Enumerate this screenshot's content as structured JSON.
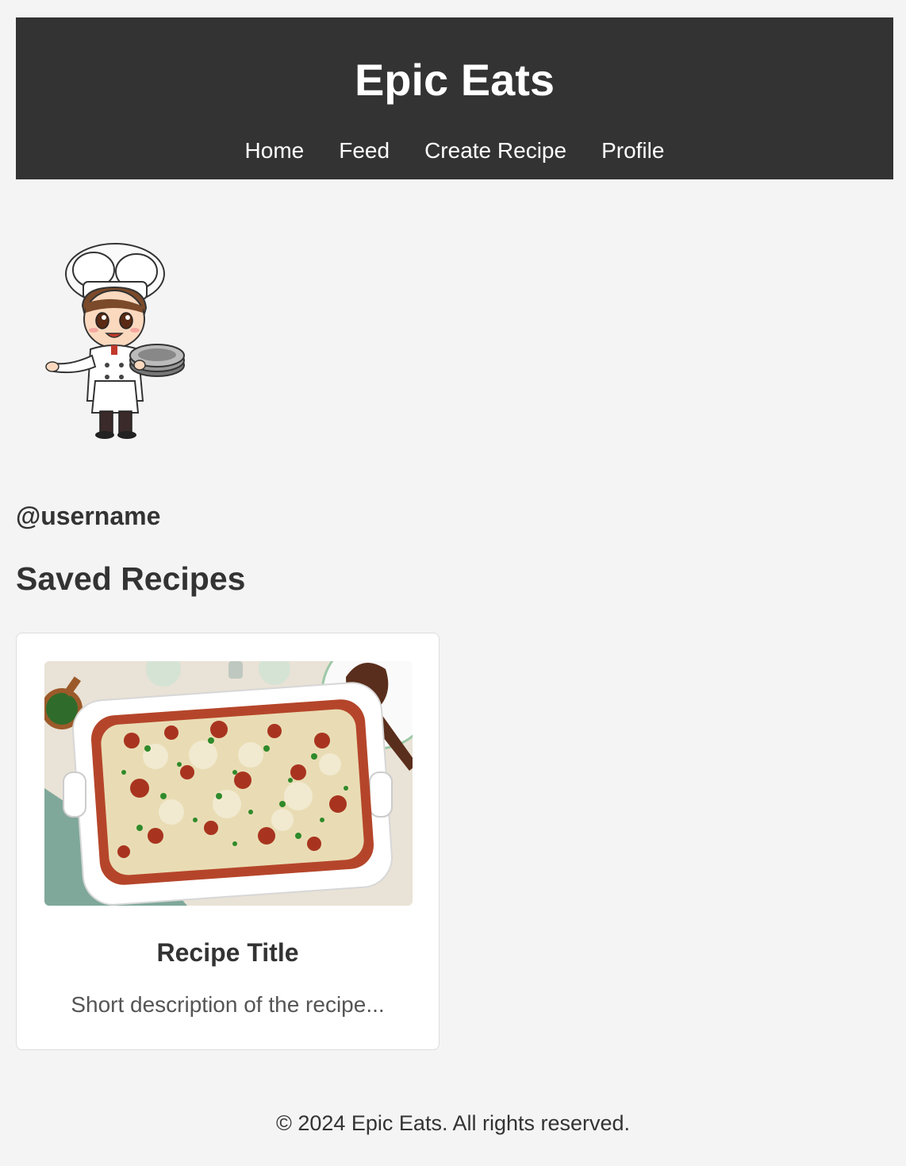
{
  "header": {
    "title": "Epic Eats",
    "nav": [
      {
        "label": "Home"
      },
      {
        "label": "Feed"
      },
      {
        "label": "Create Recipe"
      },
      {
        "label": "Profile"
      }
    ]
  },
  "profile": {
    "avatar_icon": "chef-illustration",
    "username": "@username"
  },
  "saved": {
    "heading": "Saved Recipes",
    "recipes": [
      {
        "image_icon": "lasagna-photo",
        "title": "Recipe Title",
        "description": "Short description of the recipe..."
      }
    ]
  },
  "footer": {
    "text": "© 2024 Epic Eats. All rights reserved."
  },
  "colors": {
    "header_bg": "#333333",
    "page_bg": "#f4f4f4",
    "card_bg": "#ffffff"
  }
}
